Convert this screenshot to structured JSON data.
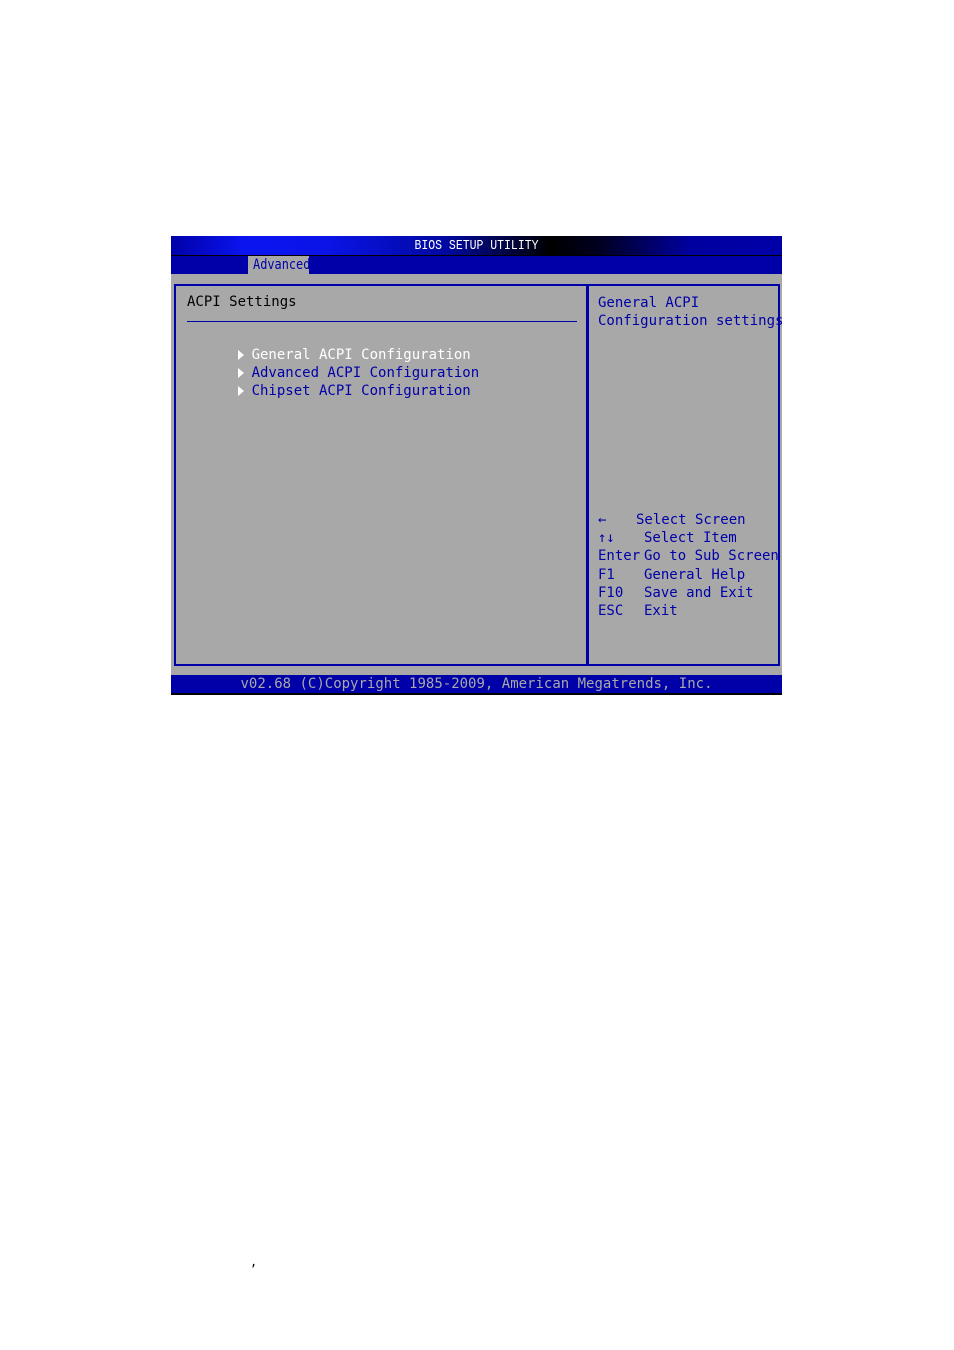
{
  "window": {
    "title": "BIOS SETUP UTILITY",
    "active_tab": "Advanced",
    "footer": "v02.68 (C)Copyright 1985-2009, American Megatrends, Inc."
  },
  "main": {
    "heading": "ACPI Settings",
    "menu_items": [
      {
        "label": "General ACPI Configuration",
        "selected": true
      },
      {
        "label": "Advanced ACPI Configuration",
        "selected": false
      },
      {
        "label": "Chipset ACPI Configuration",
        "selected": false
      }
    ]
  },
  "help": {
    "lines": [
      "General ACPI",
      "Configuration settings"
    ],
    "keys": [
      {
        "key": "←",
        "action": "Select Screen"
      },
      {
        "key": "↑↓",
        "action": "Select Item"
      },
      {
        "key": "Enter",
        "action": "Go to Sub Screen"
      },
      {
        "key": "F1",
        "action": "General Help"
      },
      {
        "key": "F10",
        "action": "Save and Exit"
      },
      {
        "key": "ESC",
        "action": "Exit"
      }
    ]
  },
  "page": {
    "stray_mark": ","
  },
  "colors": {
    "bios_blue": "#0000a8",
    "bios_gray": "#a8a8a8",
    "selected_text": "#ffffff"
  }
}
